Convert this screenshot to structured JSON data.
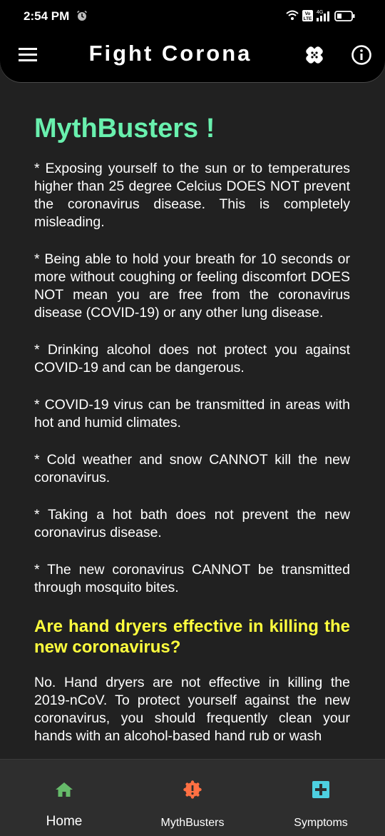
{
  "status_bar": {
    "time": "2:54 PM",
    "network": "4G",
    "icons": [
      "alarm-icon",
      "wifi-icon",
      "volte-icon",
      "signal-icon",
      "battery-icon"
    ]
  },
  "header": {
    "title": "Fight Corona",
    "icons": [
      "menu-icon",
      "virus-icon",
      "info-icon"
    ]
  },
  "content": {
    "title": "MythBusters !",
    "myths": [
      "* Exposing yourself to the sun or to temperatures higher than 25 degree Celcius DOES NOT prevent the coronavirus disease. This is completely misleading.",
      "* Being able to hold your breath for 10 seconds or more without coughing or feeling discomfort DOES NOT mean you are free from the coronavirus disease (COVID-19) or any other lung disease.",
      "* Drinking alcohol does not protect you against COVID-19 and can be dangerous.",
      "* COVID-19 virus can be transmitted in areas with hot and humid climates.",
      "* Cold weather and snow CANNOT kill the new coronavirus.",
      "* Taking a hot bath does not prevent the new coronavirus disease.",
      "* The new coronavirus CANNOT be transmitted through mosquito bites."
    ],
    "question": "Are hand dryers effective in killing the new coronavirus?",
    "answer": "No. Hand dryers are not effective in killing the 2019-nCoV. To protect yourself against the new coronavirus, you should frequently clean your hands with an alcohol-based hand rub or wash"
  },
  "bottom_nav": {
    "items": [
      {
        "label": "Home",
        "icon": "home-icon"
      },
      {
        "label": "MythBusters",
        "icon": "alert-badge-icon"
      },
      {
        "label": "Symptoms",
        "icon": "medical-cross-icon"
      }
    ]
  },
  "colors": {
    "background": "#212121",
    "title_green": "#69f0ae",
    "subhead_yellow": "#ffff3d",
    "home_icon": "#66bb6a",
    "myth_icon": "#ff7043",
    "symptoms_icon": "#4dd0e1",
    "nav_bg": "#2e2e2e"
  }
}
